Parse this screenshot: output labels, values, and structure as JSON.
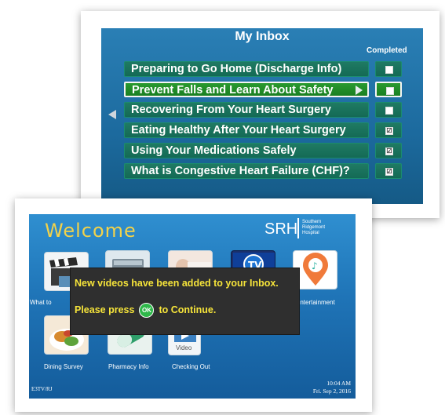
{
  "inbox": {
    "title": "My Inbox",
    "completed_label": "Completed",
    "items": [
      {
        "label": "Preparing to Go Home (Discharge Info)",
        "completed": false,
        "selected": false
      },
      {
        "label": "Prevent Falls and Learn About Safety",
        "completed": false,
        "selected": true
      },
      {
        "label": "Recovering From Your Heart Surgery",
        "completed": false,
        "selected": false
      },
      {
        "label": "Eating Healthy After Your Heart Surgery",
        "completed": true,
        "selected": false
      },
      {
        "label": "Using Your Medications Safely",
        "completed": true,
        "selected": false
      },
      {
        "label": "What is Congestive Heart Failure (CHF)?",
        "completed": true,
        "selected": false
      }
    ],
    "check_mark": "☑"
  },
  "welcome": {
    "title": "Welcome",
    "logo": {
      "abbr": "SRH",
      "line1": "Southern",
      "line2": "Ridgemont",
      "line3": "Hospital"
    },
    "tiles": {
      "what_to": "What to",
      "entertainment": "Entertainment",
      "dining_survey": "Dining Survey",
      "pharmacy_info": "Pharmacy Info",
      "checking_out": "Checking Out",
      "video_badge": "Video"
    },
    "notice": {
      "line1": "New videos have been added to your Inbox.",
      "line2_before": "Please press",
      "ok_label": "OK",
      "line2_after": "to Continue."
    },
    "footer_left": "E3TV/RJ",
    "time": "10:04 AM",
    "date": "Fri. Sep 2, 2016"
  },
  "colors": {
    "accent_yellow": "#f6e43a",
    "title_gold": "#f2d24a",
    "row_green": "#146a55",
    "selected_green": "#1a7f22",
    "ok_green": "#2fb84a"
  }
}
